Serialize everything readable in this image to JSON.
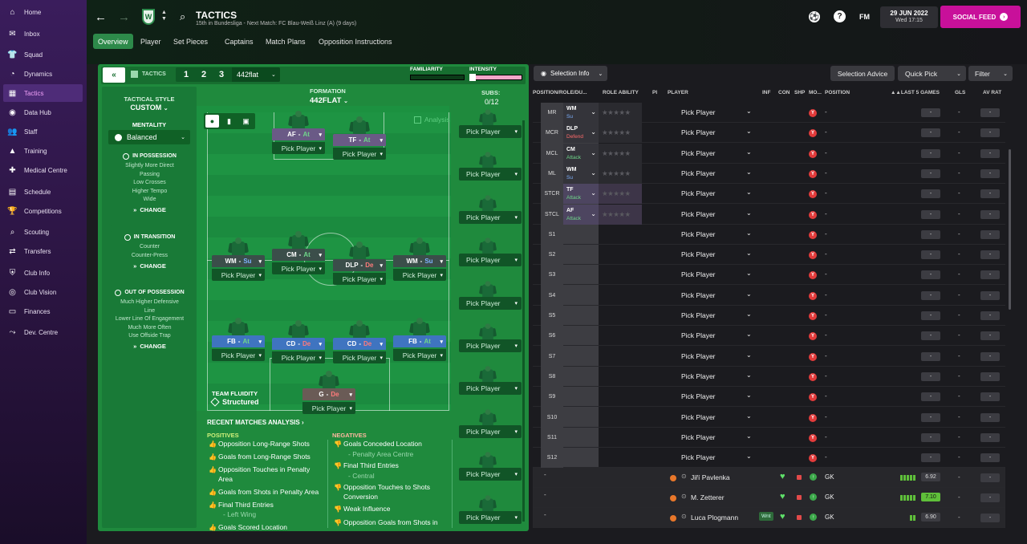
{
  "nav": [
    {
      "label": "Home",
      "icon": "⌂"
    },
    {
      "label": "Inbox",
      "icon": "✉"
    },
    {
      "label": "Squad",
      "icon": "👕"
    },
    {
      "label": "Dynamics",
      "icon": "◔"
    },
    {
      "label": "Tactics",
      "icon": "▦"
    },
    {
      "label": "Data Hub",
      "icon": "◉"
    },
    {
      "label": "Staff",
      "icon": "👥"
    },
    {
      "label": "Training",
      "icon": "▲"
    },
    {
      "label": "Medical Centre",
      "icon": "✚"
    },
    {
      "label": "Schedule",
      "icon": "▤"
    },
    {
      "label": "Competitions",
      "icon": "🏆"
    },
    {
      "label": "Scouting",
      "icon": "⌕"
    },
    {
      "label": "Transfers",
      "icon": "⇄"
    },
    {
      "label": "Club Info",
      "icon": "⛨"
    },
    {
      "label": "Club Vision",
      "icon": "◎"
    },
    {
      "label": "Finances",
      "icon": "▭"
    },
    {
      "label": "Dev. Centre",
      "icon": "⤳"
    }
  ],
  "header": {
    "title": "TACTICS",
    "subtitle": "15th in Bundesliga - Next Match: FC Blau-Weiß Linz (A) (9 days)",
    "fm": "FM",
    "date": "29 JUN 2022",
    "time": "Wed 17:15",
    "social": "SOCIAL FEED"
  },
  "tabs": [
    "Overview",
    "Player",
    "Set Pieces",
    "Captains",
    "Match Plans",
    "Opposition Instructions"
  ],
  "tactics_bar": {
    "label": "TACTICS",
    "slots": [
      "1",
      "2",
      "3"
    ],
    "name": "442flat",
    "familiarity": "FAMILIARITY",
    "intensity": "INTENSITY"
  },
  "style": {
    "title": "TACTICAL STYLE",
    "value": "CUSTOM",
    "mentality_label": "MENTALITY",
    "mentality": "Balanced",
    "in_possession": {
      "title": "IN POSSESSION",
      "lines": [
        "Slightly More Direct",
        "Passing",
        "Low Crosses",
        "Higher Tempo",
        "Wide"
      ]
    },
    "in_transition": {
      "title": "IN TRANSITION",
      "lines": [
        "Counter",
        "Counter-Press"
      ]
    },
    "out_possession": {
      "title": "OUT OF POSSESSION",
      "lines": [
        "Much Higher Defensive",
        "Line",
        "Lower Line Of Engagement",
        "Much More Often",
        "Use Offside Trap"
      ]
    },
    "change": "CHANGE"
  },
  "formation": {
    "label": "FORMATION",
    "value": "442FLAT",
    "subs_label": "SUBS:",
    "subs": "0/12",
    "analysis": "Analysis",
    "fluidity_label": "TEAM FLUIDITY",
    "fluidity": "Structured"
  },
  "pitch_players": [
    {
      "role": "AF",
      "duty": "At",
      "pick": "Pick Player"
    },
    {
      "role": "TF",
      "duty": "At",
      "pick": "Pick Player"
    },
    {
      "role": "WM",
      "duty": "Su",
      "pick": "Pick Player"
    },
    {
      "role": "CM",
      "duty": "At",
      "pick": "Pick Player"
    },
    {
      "role": "DLP",
      "duty": "De",
      "pick": "Pick Player"
    },
    {
      "role": "WM",
      "duty": "Su",
      "pick": "Pick Player"
    },
    {
      "role": "FB",
      "duty": "At",
      "pick": "Pick Player"
    },
    {
      "role": "CD",
      "duty": "De",
      "pick": "Pick Player"
    },
    {
      "role": "CD",
      "duty": "De",
      "pick": "Pick Player"
    },
    {
      "role": "FB",
      "duty": "At",
      "pick": "Pick Player"
    },
    {
      "role": "G",
      "duty": "De",
      "pick": "Pick Player"
    }
  ],
  "subs_pick": "Pick Player",
  "analysis": {
    "title": "RECENT MATCHES ANALYSIS ›",
    "positives_label": "POSITIVES",
    "negatives_label": "NEGATIVES",
    "positives": [
      "Opposition Long-Range Shots",
      "Goals from Long-Range Shots",
      "Opposition Touches in Penalty",
      "Area",
      "Goals from Shots in Penalty Area",
      "Final Third Entries",
      "- Left Wing",
      "Goals Scored Location"
    ],
    "negatives": [
      "Goals Conceded Location",
      "- Penalty Area Centre",
      "Final Third Entries",
      "- Central",
      "Opposition Touches to Shots",
      "Conversion",
      "Weak Influence",
      "Opposition Goals from Shots in"
    ]
  },
  "right": {
    "selection_info": "Selection Info",
    "selection_advice": "Selection Advice",
    "quick_pick": "Quick Pick",
    "filter": "Filter",
    "columns": {
      "pos": "POSITION/ROLE/DU...",
      "ability": "ROLE ABILITY",
      "pi": "PI",
      "player": "PLAYER",
      "inf": "INF",
      "con": "CON",
      "shp": "SHP",
      "mo": "MO...",
      "position": "POSITION",
      "last5": "▲▲LAST 5 GAMES",
      "gls": "GLS",
      "avrat": "AV RAT"
    },
    "rows": [
      {
        "pos": "MR",
        "role": "WM",
        "duty": "Su",
        "duty_color": "#7fb2ff",
        "player": "Pick Player",
        "position": "-"
      },
      {
        "pos": "MCR",
        "role": "DLP",
        "duty": "Defend",
        "duty_color": "#ff6b6b",
        "player": "Pick Player",
        "position": "-"
      },
      {
        "pos": "MCL",
        "role": "CM",
        "duty": "Attack",
        "duty_color": "#6fd68a",
        "player": "Pick Player",
        "position": "-"
      },
      {
        "pos": "ML",
        "role": "WM",
        "duty": "Su",
        "duty_color": "#7fb2ff",
        "player": "Pick Player",
        "position": "-"
      },
      {
        "pos": "STCR",
        "role": "TF",
        "duty": "Attack",
        "duty_color": "#6fd68a",
        "player": "Pick Player",
        "position": "-"
      },
      {
        "pos": "STCL",
        "role": "AF",
        "duty": "Attack",
        "duty_color": "#6fd68a",
        "player": "Pick Player",
        "position": "-"
      },
      {
        "pos": "S1",
        "player": "Pick Player",
        "position": "-"
      },
      {
        "pos": "S2",
        "player": "Pick Player",
        "position": "-"
      },
      {
        "pos": "S3",
        "player": "Pick Player",
        "position": "-"
      },
      {
        "pos": "S4",
        "player": "Pick Player",
        "position": "-"
      },
      {
        "pos": "S5",
        "player": "Pick Player",
        "position": "-"
      },
      {
        "pos": "S6",
        "player": "Pick Player",
        "position": "-"
      },
      {
        "pos": "S7",
        "player": "Pick Player",
        "position": "-"
      },
      {
        "pos": "S8",
        "player": "Pick Player",
        "position": "-"
      },
      {
        "pos": "S9",
        "player": "Pick Player",
        "position": "-"
      },
      {
        "pos": "S10",
        "player": "Pick Player",
        "position": "-"
      },
      {
        "pos": "S11",
        "player": "Pick Player",
        "position": "-"
      },
      {
        "pos": "S12",
        "player": "Pick Player",
        "position": "-"
      }
    ],
    "players": [
      {
        "name": "Jiří Pavlenka",
        "position": "GK",
        "rating": "6.92",
        "gls": "-",
        "av": "-"
      },
      {
        "name": "M. Zetterer",
        "position": "GK",
        "rating": "7.10",
        "gls": "-",
        "av": "-"
      },
      {
        "name": "Luca Plogmann",
        "position": "GK",
        "rating": "6.90",
        "gls": "-",
        "av": "-",
        "tag": "Wnt"
      }
    ]
  },
  "colors": {
    "accent": "#c8109a",
    "pitch": "#1c9140",
    "attack": "#3f7bd0",
    "defend": "#4a7bb0"
  }
}
